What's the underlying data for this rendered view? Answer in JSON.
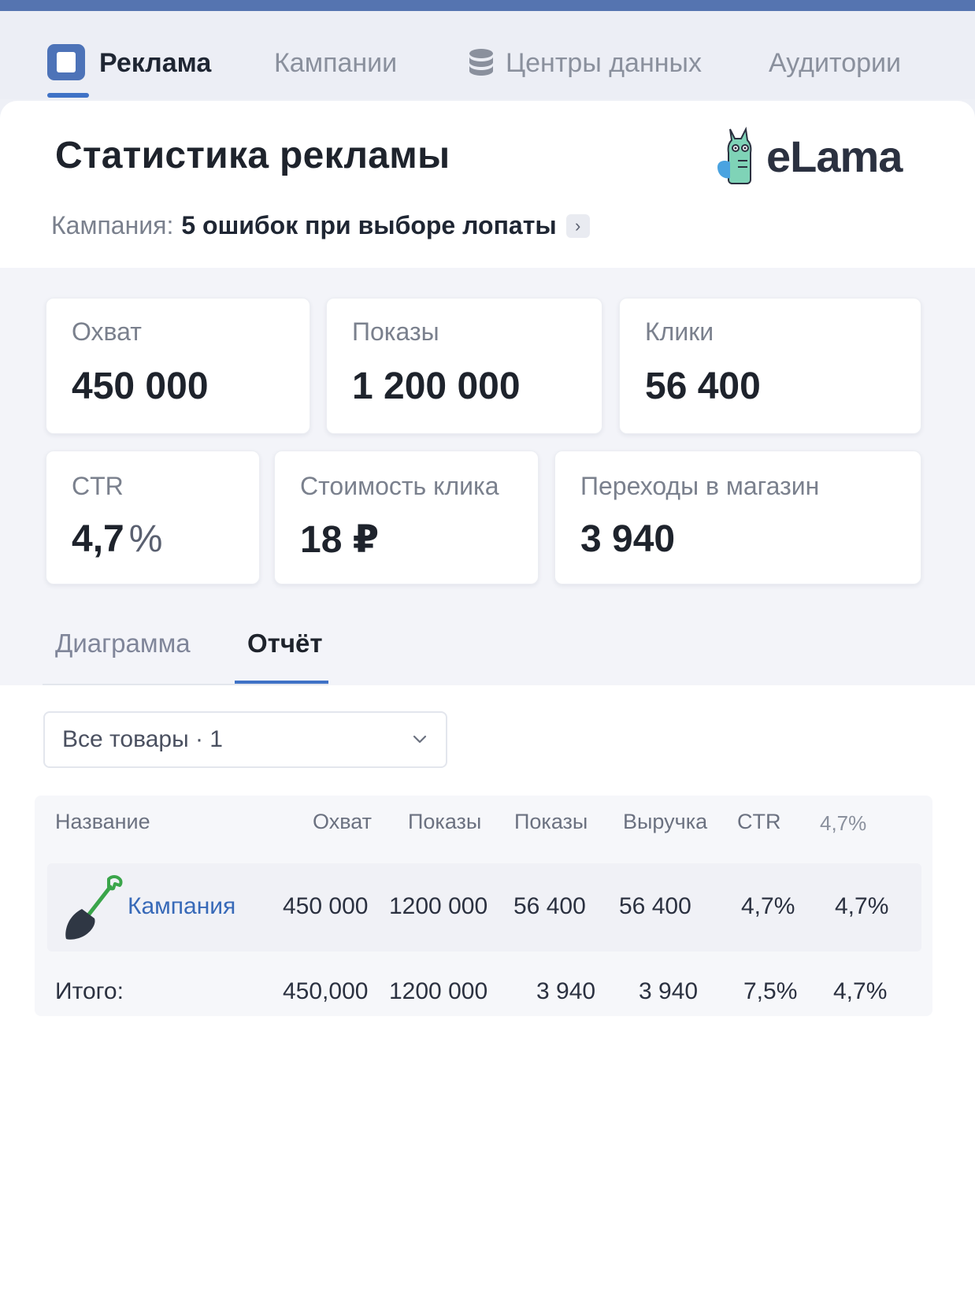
{
  "nav": {
    "items": [
      {
        "label": "Реклама",
        "active": true,
        "icon": "ad-square-icon"
      },
      {
        "label": "Кампании",
        "active": false
      },
      {
        "label": "Центры данных",
        "active": false,
        "icon": "database-icon"
      },
      {
        "label": "Аудитории",
        "active": false
      }
    ]
  },
  "page": {
    "title": "Статистика рекламы",
    "logo_text": "eLama",
    "campaign_label": "Кампания:",
    "campaign_name": "5 ошибок при выборе лопаты",
    "campaign_chevron": "›"
  },
  "metrics": {
    "reach": {
      "label": "Охват",
      "value": "450 000"
    },
    "impressions": {
      "label": "Показы",
      "value": "1 200 000"
    },
    "clicks": {
      "label": "Клики",
      "value": "56 400"
    },
    "ctr": {
      "label": "CTR",
      "value": "4,7",
      "unit": "%"
    },
    "cpc": {
      "label": "Стоимость клика",
      "value": "18 ₽"
    },
    "shop": {
      "label": "Переходы в магазин",
      "value": "3 940"
    }
  },
  "view_tabs": {
    "diagram": "Диаграмма",
    "report": "Отчёт",
    "active": "report"
  },
  "filter": {
    "value": "Все товары · 1"
  },
  "table": {
    "headers": [
      "Название",
      "Охват",
      "Показы",
      "Показы",
      "Выручка",
      "CTR",
      "4,7%"
    ],
    "row": {
      "icon": "shovel-icon",
      "name": "Кампания",
      "cells": [
        "450 000",
        "1200 000",
        "56 400",
        "56 400",
        "4,7%",
        "4,7%"
      ]
    },
    "total": {
      "label": "Итого:",
      "cells": [
        "450,000",
        "1200 000",
        "3 940",
        "3 940",
        "7,5%",
        "4,7%"
      ]
    }
  },
  "colors": {
    "accent": "#3f72c6",
    "link": "#3769b8",
    "brand_bar": "#5574b0"
  }
}
